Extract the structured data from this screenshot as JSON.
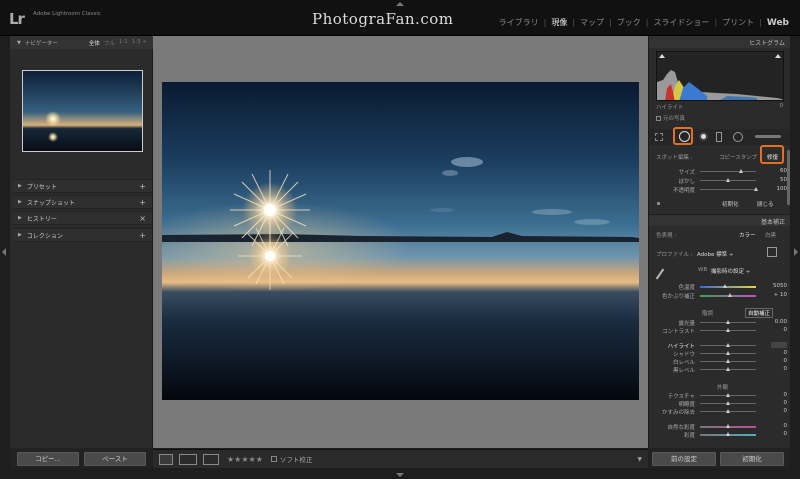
{
  "topbar": {
    "logo": "Lr",
    "app_name": "Adobe Lightroom Classic",
    "brand": "PhotograFan.com",
    "modules": [
      "ライブラリ",
      "現像",
      "マップ",
      "ブック",
      "スライドショー",
      "プリント",
      "Web"
    ],
    "active_module": "現像"
  },
  "navigator": {
    "title": "ナビゲーター",
    "zoom_options": [
      "全体",
      "フル",
      "1:1",
      "1:3 ÷"
    ],
    "selected_zoom": "全体"
  },
  "left_panels": [
    {
      "label": "プリセット",
      "action": "+"
    },
    {
      "label": "スナップショット",
      "action": "+"
    },
    {
      "label": "ヒストリー",
      "action": "×"
    },
    {
      "label": "コレクション",
      "action": "+"
    }
  ],
  "left_buttons": {
    "copy": "コピー...",
    "paste": "ペースト"
  },
  "toolbar": {
    "rating": "★★★★★",
    "soft_proof": "ソフト校正"
  },
  "right_panel": {
    "histogram_title": "ヒストグラム",
    "highlight_label": "ハイライト",
    "highlight_value": "0",
    "original_photo_label": "元の写真",
    "spot_edit_label": "スポット編集 :",
    "clone_label": "コピースタンプ",
    "heal_label": "修復",
    "spot_sliders": [
      {
        "label": "サイズ",
        "value": "60",
        "pos": 0.72
      },
      {
        "label": "ぼかし",
        "value": "50",
        "pos": 0.5
      },
      {
        "label": "不透明度",
        "value": "100",
        "pos": 1.0
      }
    ],
    "reset_label": "初期化",
    "close_label": "閉じる",
    "basic_title": "基本補正",
    "treatment_label": "色表現 :",
    "color_label": "カラー",
    "bw_label": "白黒",
    "profile_label": "プロファイル :",
    "profile_value": "Adobe 標準 ÷",
    "wb_label": "WB :",
    "wb_value": "撮影時の設定 ÷",
    "temp": {
      "label": "色温度",
      "value": "5050",
      "pos": 0.45
    },
    "tint": {
      "label": "色かぶり補正",
      "value": "+ 10",
      "pos": 0.52
    },
    "tone_label": "階調",
    "auto_label": "自動補正",
    "tone_sliders": [
      {
        "label": "露光量",
        "value": "0.00",
        "pos": 0.5
      },
      {
        "label": "コントラスト",
        "value": "0",
        "pos": 0.5
      },
      {
        "label": "ハイライト",
        "value": "",
        "pos": 0.5,
        "active": true
      },
      {
        "label": "シャドウ",
        "value": "0",
        "pos": 0.5
      },
      {
        "label": "白レベル",
        "value": "0",
        "pos": 0.5
      },
      {
        "label": "黒レベル",
        "value": "0",
        "pos": 0.5
      }
    ],
    "presence_label": "外観",
    "presence_sliders": [
      {
        "label": "テクスチャ",
        "value": "0",
        "pos": 0.5
      },
      {
        "label": "明瞭度",
        "value": "0",
        "pos": 0.5
      },
      {
        "label": "かすみの除去",
        "value": "0",
        "pos": 0.5
      }
    ],
    "vibrance_sliders": [
      {
        "label": "自然な彩度",
        "value": "0",
        "pos": 0.5
      },
      {
        "label": "彩度",
        "value": "0",
        "pos": 0.5
      }
    ],
    "highlight_color": "#e2701f"
  },
  "right_buttons": {
    "previous": "前の設定",
    "reset": "初期化"
  }
}
